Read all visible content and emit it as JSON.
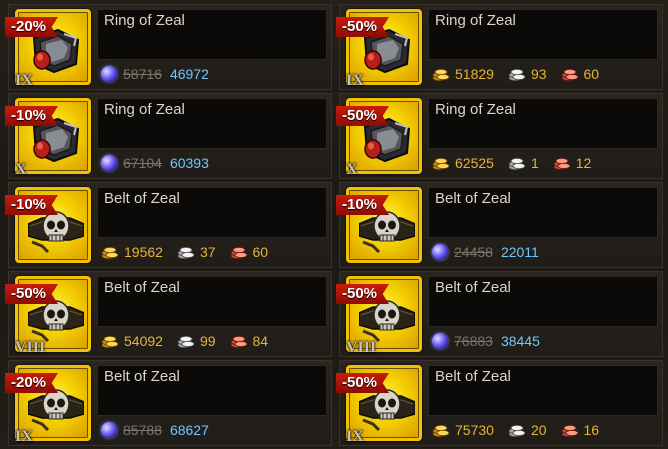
{
  "cards": [
    {
      "name": "Ring of Zeal",
      "discount": "-20%",
      "tier": "IX",
      "kind": "ring",
      "price": {
        "type": "gem",
        "old": "58716",
        "new": "46972"
      }
    },
    {
      "name": "Ring of Zeal",
      "discount": "-50%",
      "tier": "IX",
      "kind": "ring",
      "price": {
        "type": "coins",
        "gold": "51829",
        "silver": "93",
        "copper": "60"
      }
    },
    {
      "name": "Ring of Zeal",
      "discount": "-10%",
      "tier": "X",
      "kind": "ring",
      "price": {
        "type": "gem",
        "old": "67104",
        "new": "60393"
      }
    },
    {
      "name": "Ring of Zeal",
      "discount": "-50%",
      "tier": "X",
      "kind": "ring",
      "price": {
        "type": "coins",
        "gold": "62525",
        "silver": "1",
        "copper": "12"
      }
    },
    {
      "name": "Belt of Zeal",
      "discount": "-10%",
      "tier": "",
      "kind": "belt",
      "price": {
        "type": "coins",
        "gold": "19562",
        "silver": "37",
        "copper": "60"
      }
    },
    {
      "name": "Belt of Zeal",
      "discount": "-10%",
      "tier": "",
      "kind": "belt",
      "price": {
        "type": "gem",
        "old": "24458",
        "new": "22011"
      }
    },
    {
      "name": "Belt of Zeal",
      "discount": "-50%",
      "tier": "VIII",
      "kind": "belt",
      "price": {
        "type": "coins",
        "gold": "54092",
        "silver": "99",
        "copper": "84"
      }
    },
    {
      "name": "Belt of Zeal",
      "discount": "-50%",
      "tier": "VIII",
      "kind": "belt",
      "price": {
        "type": "gem",
        "old": "76883",
        "new": "38445"
      }
    },
    {
      "name": "Belt of Zeal",
      "discount": "-20%",
      "tier": "IX",
      "kind": "belt",
      "price": {
        "type": "gem",
        "old": "85788",
        "new": "68627"
      }
    },
    {
      "name": "Belt of Zeal",
      "discount": "-50%",
      "tier": "IX",
      "kind": "belt",
      "price": {
        "type": "coins",
        "gold": "75730",
        "silver": "20",
        "copper": "16"
      }
    }
  ],
  "icons": {
    "gem": "sapphire-gem-icon",
    "gold": "gold-coins-icon",
    "silver": "silver-coins-icon",
    "copper": "copper-coins-icon"
  },
  "colors": {
    "discount_badge": "#c81c0d",
    "item_frame": "#f2c200",
    "coin_value": "#e8b33a",
    "gem_value": "#6fc8ff",
    "old_price": "#7a746a"
  }
}
